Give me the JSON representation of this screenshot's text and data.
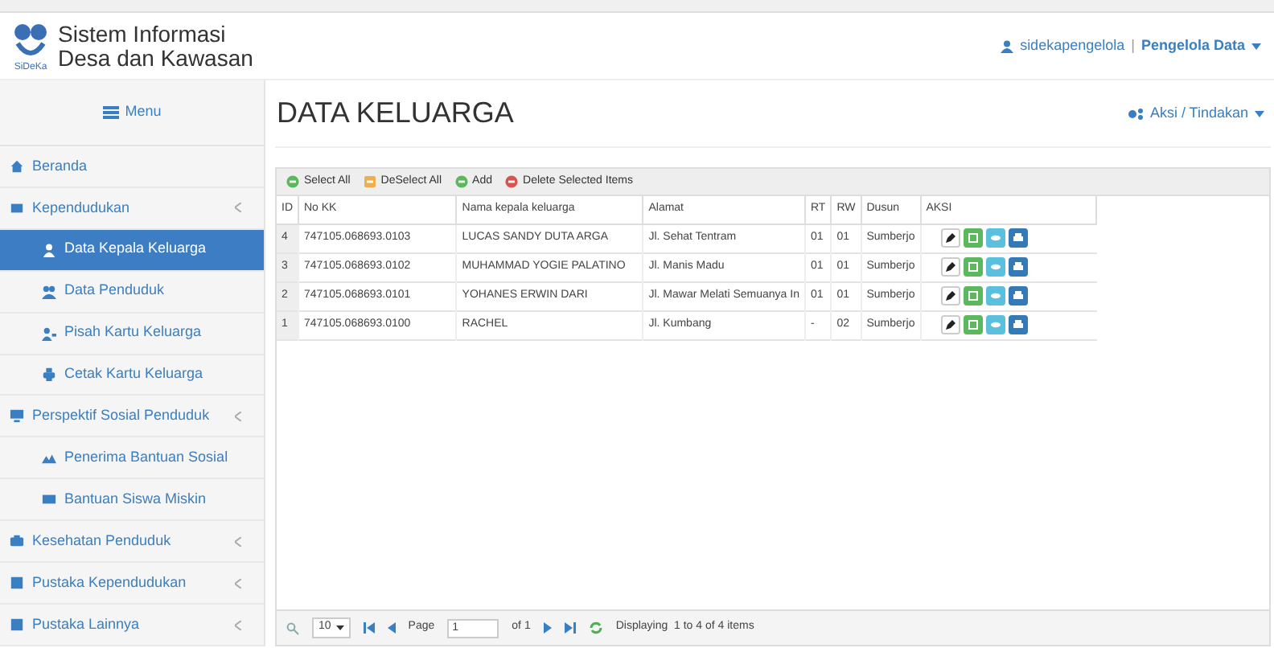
{
  "header": {
    "logo_caption": "SiDeKa",
    "app_title_line1": "Sistem Informasi",
    "app_title_line2": "Desa dan Kawasan",
    "user": "sidekapengelola",
    "separator": "|",
    "role": "Pengelola Data"
  },
  "sidebar": {
    "menu_label": "Menu",
    "items": [
      {
        "label": "Beranda",
        "selected": false,
        "submenu": false
      },
      {
        "label": "Kependudukan",
        "selected": false,
        "submenu": true,
        "children": [
          {
            "label": "Data Kepala Keluarga",
            "selected": true
          },
          {
            "label": "Data Penduduk",
            "selected": false
          },
          {
            "label": "Pisah Kartu Keluarga",
            "selected": false
          },
          {
            "label": "Cetak Kartu Keluarga",
            "selected": false
          }
        ]
      },
      {
        "label": "Perspektif Sosial Penduduk",
        "selected": false,
        "submenu": true,
        "children": [
          {
            "label": "Penerima Bantuan Sosial",
            "selected": false
          },
          {
            "label": "Bantuan Siswa Miskin",
            "selected": false
          }
        ]
      },
      {
        "label": "Kesehatan Penduduk",
        "selected": false,
        "submenu": true
      },
      {
        "label": "Pustaka Kependudukan",
        "selected": false,
        "submenu": true
      },
      {
        "label": "Pustaka Lainnya",
        "selected": false,
        "submenu": true
      }
    ]
  },
  "page": {
    "title": "DATA KELUARGA",
    "actions_menu": "Aksi / Tindakan"
  },
  "toolbar": [
    "Select All",
    "DeSelect All",
    "Add",
    "Delete Selected Items"
  ],
  "table": {
    "columns": [
      "ID",
      "No KK",
      "Nama kepala keluarga",
      "Alamat",
      "RT",
      "RW",
      "Dusun",
      "AKSI"
    ],
    "rows": [
      [
        "4",
        "747105.068693.0103",
        "LUCAS SANDY DUTA ARGA",
        "Jl. Sehat Tentram",
        "01",
        "01",
        "Sumberjo"
      ],
      [
        "3",
        "747105.068693.0102",
        "MUHAMMAD YOGIE PALATINO",
        "Jl. Manis Madu",
        "01",
        "01",
        "Sumberjo"
      ],
      [
        "2",
        "747105.068693.0101",
        "YOHANES ERWIN DARI",
        "Jl. Mawar Melati Semuanya In",
        "01",
        "01",
        "Sumberjo"
      ],
      [
        "1",
        "747105.068693.0100",
        "RACHEL",
        "Jl. Kumbang",
        "-",
        "02",
        "Sumberjo"
      ]
    ]
  },
  "pager": {
    "page_size": "10",
    "page_label": "Page",
    "page_value": "1",
    "of_label": "of 1",
    "status": "Displaying  1 to 4 of 4 items"
  }
}
